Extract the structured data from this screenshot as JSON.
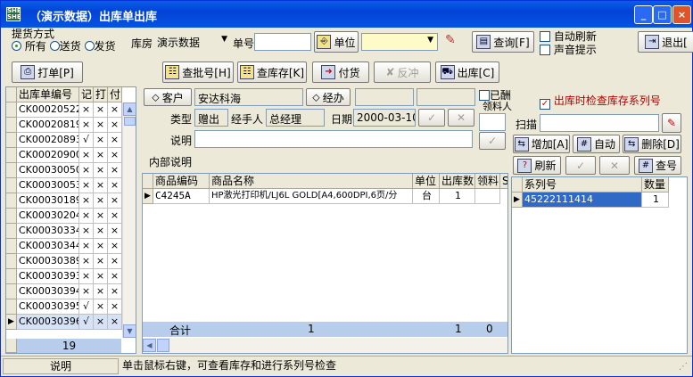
{
  "window": {
    "title": "（演示数据）出库单出库",
    "icon": "SHE SHE"
  },
  "titlebar_buttons": {
    "minimize": "_",
    "maximize": "□",
    "close": "×"
  },
  "delivery_mode": {
    "label": "提货方式",
    "options": [
      "所有",
      "送货",
      "发货"
    ],
    "selected": "所有"
  },
  "warehouse": {
    "label": "库房",
    "value": "演示数据"
  },
  "doc_no": {
    "label": "单号",
    "value": ""
  },
  "unit_button": "单位",
  "unit_value": "",
  "query_button": "查询[F]",
  "auto_refresh": "自动刷新",
  "sound_prompt": "声音提示",
  "exit_button": "退出[",
  "toolbar": {
    "print": "打单[P]",
    "batch": "查批号[H]",
    "stock": "查库存[K]",
    "pay": "付货",
    "reverse": "反冲",
    "outbound": "出库[C]"
  },
  "order_list": {
    "headers": [
      "出库单编号",
      "记",
      "打",
      "付"
    ],
    "rows": [
      {
        "id": "CK00020522",
        "rec": "×",
        "prt": "×",
        "pay": "×"
      },
      {
        "id": "CK00020819",
        "rec": "×",
        "prt": "×",
        "pay": "×"
      },
      {
        "id": "CK00020893",
        "rec": "√",
        "prt": "×",
        "pay": "×"
      },
      {
        "id": "CK00020900",
        "rec": "×",
        "prt": "×",
        "pay": "×"
      },
      {
        "id": "CK00030050",
        "rec": "×",
        "prt": "×",
        "pay": "×"
      },
      {
        "id": "CK00030053",
        "rec": "×",
        "prt": "×",
        "pay": "×"
      },
      {
        "id": "CK00030189",
        "rec": "×",
        "prt": "×",
        "pay": "×"
      },
      {
        "id": "CK00030204",
        "rec": "×",
        "prt": "×",
        "pay": "×"
      },
      {
        "id": "CK00030334",
        "rec": "×",
        "prt": "×",
        "pay": "×"
      },
      {
        "id": "CK00030344",
        "rec": "×",
        "prt": "×",
        "pay": "×"
      },
      {
        "id": "CK00030389",
        "rec": "×",
        "prt": "×",
        "pay": "×"
      },
      {
        "id": "CK00030393",
        "rec": "×",
        "prt": "×",
        "pay": "×"
      },
      {
        "id": "CK00030394",
        "rec": "×",
        "prt": "×",
        "pay": "×"
      },
      {
        "id": "CK00030395",
        "rec": "√",
        "prt": "×",
        "pay": "×"
      },
      {
        "id": "CK00030396",
        "rec": "√",
        "prt": "×",
        "pay": "×"
      }
    ],
    "count": "19"
  },
  "order": {
    "customer_button": "客户",
    "customer": "安达科海",
    "handler_button": "经办",
    "handler": "",
    "settled_label": "已酬",
    "picker_label": "领料人",
    "type_label": "类型",
    "type": "赠出",
    "agent_label": "经手人",
    "agent": "总经理",
    "date_label": "日期",
    "date": "2000-03-10",
    "note_label": "说明",
    "note": "",
    "internal_label": "内部说明",
    "internal": ""
  },
  "items": {
    "headers": [
      "商品编码",
      "商品名称",
      "单位",
      "出库数",
      "领料",
      "S"
    ],
    "rows": [
      {
        "code": "C4245A",
        "name": "HP激光打印机/LJ6L GOLD[A4,600DPI,6页/分",
        "unit": "台",
        "qty": "1",
        "picked": ""
      }
    ],
    "total_label": "合计",
    "total_count": "1",
    "total_qty": "1",
    "total_picked": "0"
  },
  "serial": {
    "check_label": "出库时检查库存系列号",
    "scan_label": "扫描",
    "scan_value": "",
    "add": "增加[A]",
    "auto": "自动",
    "delete": "删除[D]",
    "refresh": "刷新",
    "query": "查号",
    "headers": [
      "系列号",
      "数量"
    ],
    "rows": [
      {
        "sn": "45222111414",
        "qty": "1"
      }
    ]
  },
  "statusbar": {
    "label": "说明",
    "text": "单击鼠标右键，可查看库存和进行系列号检查"
  }
}
